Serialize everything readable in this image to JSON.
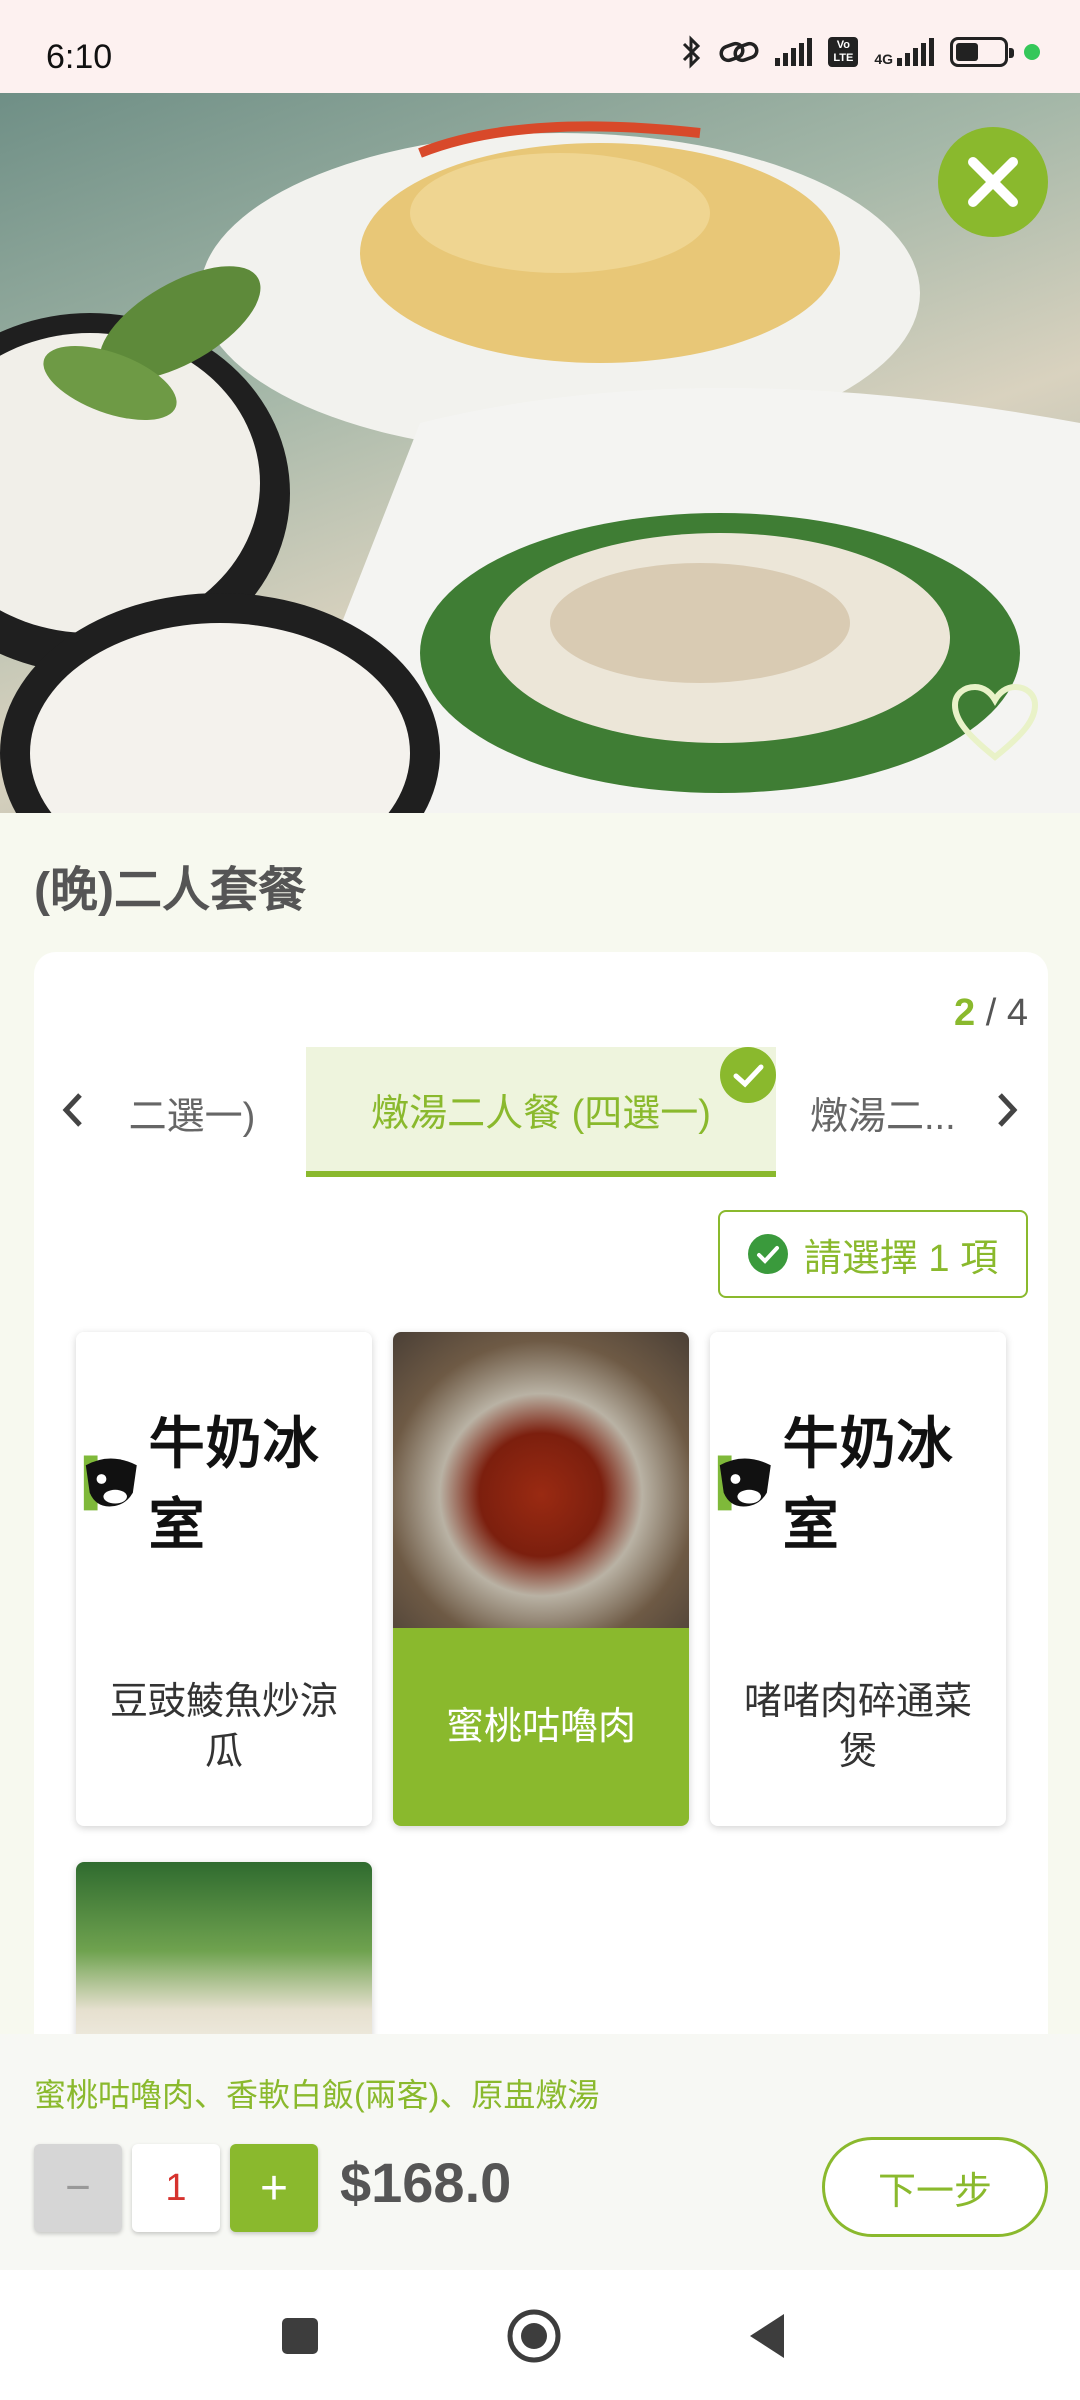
{
  "status_bar": {
    "time": "6:10",
    "network": "4G"
  },
  "hero": {
    "close_icon": "close-icon",
    "favorite_icon": "heart-outline-icon"
  },
  "product": {
    "title": "(晚)二人套餐"
  },
  "card": {
    "page_current": "2",
    "page_separator": " / ",
    "page_total": "4",
    "tabs": [
      {
        "label": "二選一)"
      },
      {
        "label": "燉湯二人餐 (四選一)",
        "completed": true
      },
      {
        "label": "燉湯二..."
      }
    ],
    "select_hint": "請選擇 1 項",
    "options": [
      {
        "label": "豆豉鯪魚炒涼瓜",
        "image": "logo",
        "selected": false
      },
      {
        "label": "蜜桃咕嚕肉",
        "image": "photo",
        "selected": true
      },
      {
        "label": "啫啫肉碎通菜煲",
        "image": "logo",
        "selected": false
      },
      {
        "label": "",
        "image": "photo",
        "selected": false
      }
    ],
    "logo_text": "牛奶冰室"
  },
  "bottom_bar": {
    "summary": "蜜桃咕嚕肉、香軟白飯(兩客)、原盅燉湯",
    "minus_label": "−",
    "quantity": "1",
    "plus_label": "+",
    "price": "$168.0",
    "next_label": "下一步"
  },
  "colors": {
    "accent": "#8ab92d",
    "accent_light": "#eef4dd",
    "background": "#f7f9ef",
    "quantity_text": "#d6322e"
  }
}
